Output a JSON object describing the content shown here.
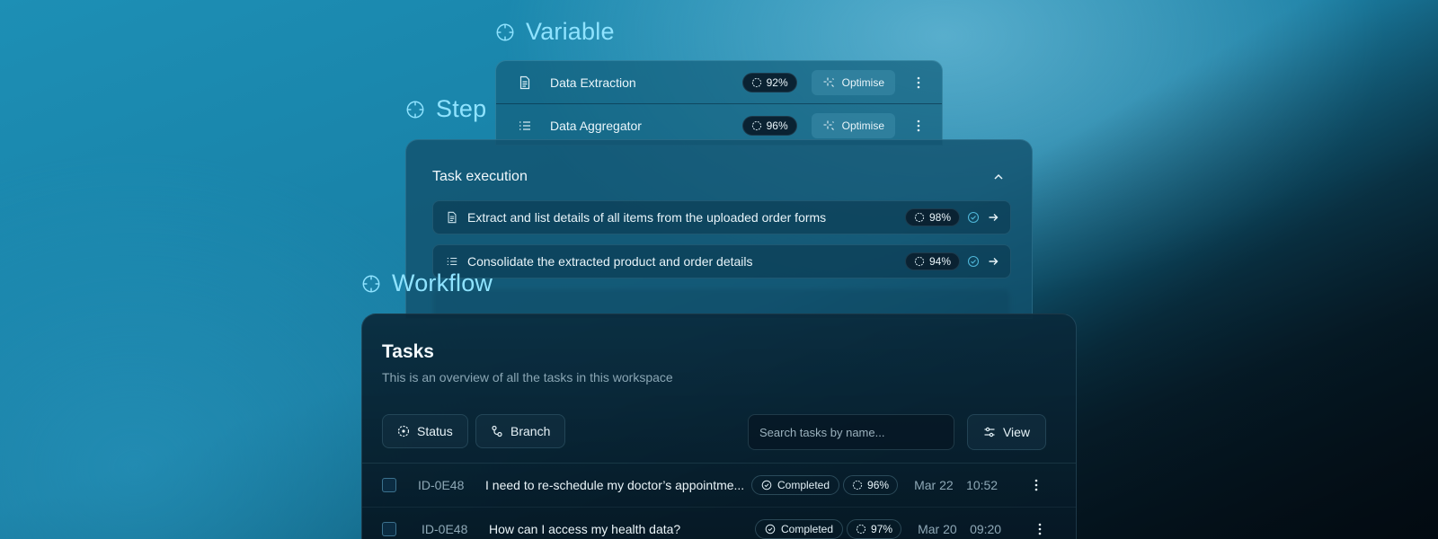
{
  "labels": {
    "variable": "Variable",
    "step": "Step",
    "workflow": "Workflow"
  },
  "variable_panel": {
    "items": [
      {
        "name": "Data Extraction",
        "score": "92%",
        "action": "Optimise",
        "icon": "document-icon"
      },
      {
        "name": "Data Aggregator",
        "score": "96%",
        "action": "Optimise",
        "icon": "list-icon"
      }
    ]
  },
  "step_panel": {
    "title": "Task execution",
    "items": [
      {
        "text": "Extract and list details of all items from the uploaded order forms",
        "score": "98%",
        "icon": "document-icon"
      },
      {
        "text": "Consolidate the extracted product and order details",
        "score": "94%",
        "icon": "list-icon"
      }
    ]
  },
  "workflow_panel": {
    "title": "Tasks",
    "subtitle": "This is an overview of all the tasks in this workspace",
    "filters": {
      "status": "Status",
      "branch": "Branch"
    },
    "search": {
      "placeholder": "Search tasks by name..."
    },
    "view_label": "View",
    "tasks": [
      {
        "id": "ID-0E48",
        "title": "I need to re-schedule my doctor’s appointme...",
        "status": "Completed",
        "score": "96%",
        "date": "Mar 22",
        "time": "10:52"
      },
      {
        "id": "ID-0E48",
        "title": "How can I access my health data?",
        "status": "Completed",
        "score": "97%",
        "date": "Mar 20",
        "time": "09:20"
      }
    ]
  },
  "colors": {
    "accent": "#8fe3ff",
    "panel_dark": "#0a2232",
    "completed_check": "#4fb6d8"
  }
}
